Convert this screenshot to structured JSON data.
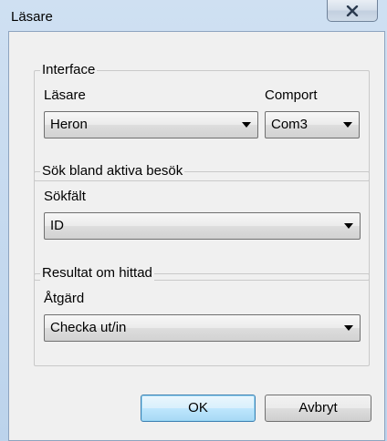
{
  "window": {
    "title": "Läsare"
  },
  "interface": {
    "group_label": "Interface",
    "reader_label": "Läsare",
    "reader_value": "Heron",
    "comport_label": "Comport",
    "comport_value": "Com3"
  },
  "search": {
    "group_label": "Sök bland aktiva besök",
    "field_label": "Sökfält",
    "field_value": "ID"
  },
  "result": {
    "group_label": "Resultat om hittad",
    "action_label": "Åtgärd",
    "action_value": "Checka ut/in"
  },
  "buttons": {
    "ok_label": "OK",
    "cancel_label": "Avbryt"
  }
}
